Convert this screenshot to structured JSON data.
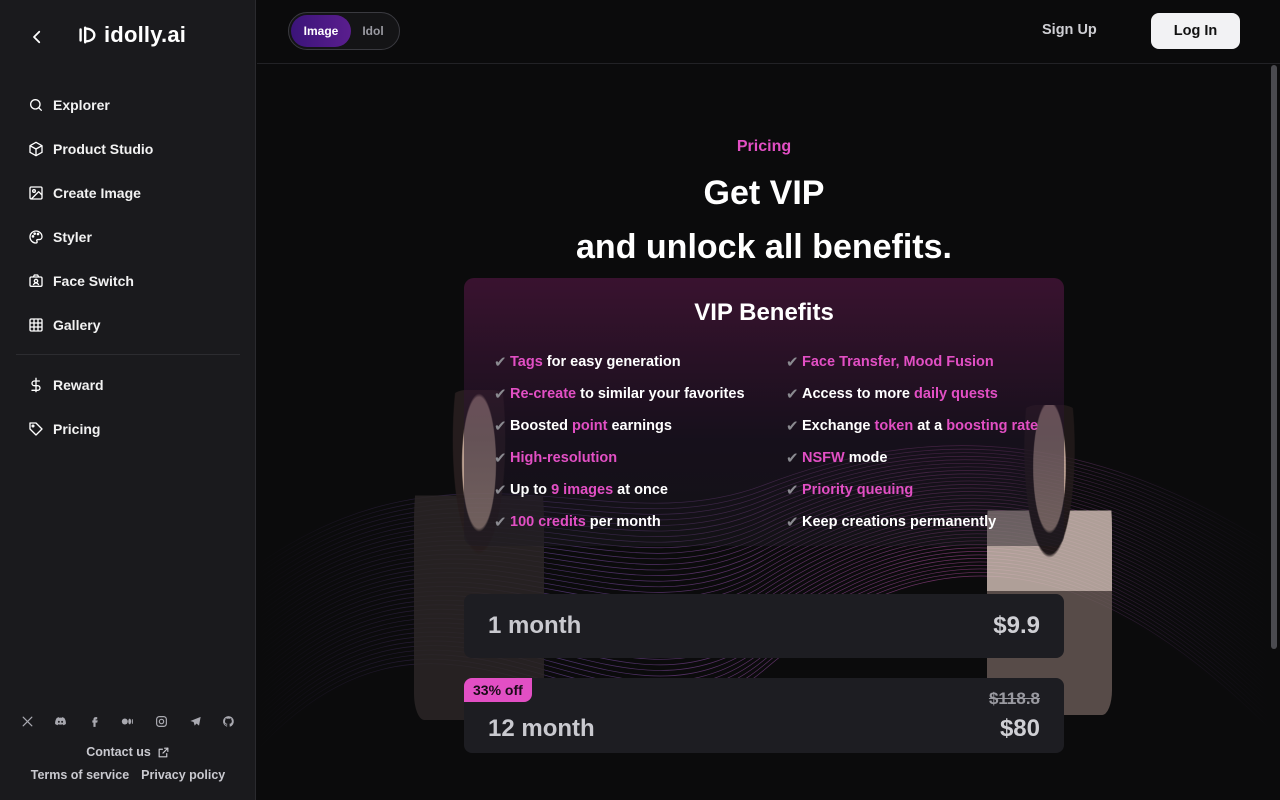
{
  "app": {
    "name": "idolly.ai"
  },
  "sidebar": {
    "items": [
      {
        "label": "Explorer",
        "icon": "search-icon"
      },
      {
        "label": "Product Studio",
        "icon": "cube-icon"
      },
      {
        "label": "Create Image",
        "icon": "image-icon"
      },
      {
        "label": "Styler",
        "icon": "palette-icon"
      },
      {
        "label": "Face Switch",
        "icon": "face-switch-icon"
      },
      {
        "label": "Gallery",
        "icon": "grid-icon"
      }
    ],
    "items_secondary": [
      {
        "label": "Reward",
        "icon": "dollar-icon"
      },
      {
        "label": "Pricing",
        "icon": "tag-icon"
      }
    ],
    "socials": [
      "x-icon",
      "discord-icon",
      "facebook-icon",
      "medium-icon",
      "instagram-icon",
      "telegram-icon",
      "github-icon"
    ],
    "contact": "Contact us",
    "terms": "Terms of service",
    "privacy": "Privacy policy"
  },
  "topbar": {
    "toggle": {
      "active": "Image",
      "inactive": "Idol"
    },
    "signup": "Sign Up",
    "login": "Log In"
  },
  "pricing": {
    "kicker": "Pricing",
    "headline_1": "Get VIP",
    "headline_2": "and unlock all benefits.",
    "benefits_title": "VIP Benefits",
    "benefits_left": [
      {
        "hl": "Tags",
        "rest": " for easy generation"
      },
      {
        "hl": "Re-create",
        "rest": " to similar your favorites"
      },
      {
        "pre": "Boosted ",
        "hl": "point",
        "rest": " earnings"
      },
      {
        "hl": "High-resolution",
        "rest": ""
      },
      {
        "pre": "Up to ",
        "hl": "9 images",
        "rest": " at once"
      },
      {
        "hl": "100 credits",
        "rest": " per month"
      }
    ],
    "benefits_right": [
      {
        "hl": "Face Transfer, Mood Fusion",
        "rest": ""
      },
      {
        "pre": "Access to more ",
        "hl": "daily quests",
        "rest": ""
      },
      {
        "pre": "Exchange ",
        "hl": "token",
        "mid": " at a ",
        "hl2": "boosting rate"
      },
      {
        "hl": "NSFW",
        "rest": " mode"
      },
      {
        "hl": "Priority queuing",
        "rest": ""
      },
      {
        "pre": "Keep creations permanently"
      }
    ],
    "check_glyph": "✔",
    "plans": [
      {
        "name": "1 month",
        "price": "$9.9"
      },
      {
        "name": "12 month",
        "price": "$80",
        "old_price": "$118.8",
        "badge": "33% off"
      }
    ]
  },
  "colors": {
    "accent": "#e24fc4",
    "toggle_active": "#4a1a86",
    "bg": "#0b0b0c",
    "sidebar": "#1a1a1d"
  }
}
